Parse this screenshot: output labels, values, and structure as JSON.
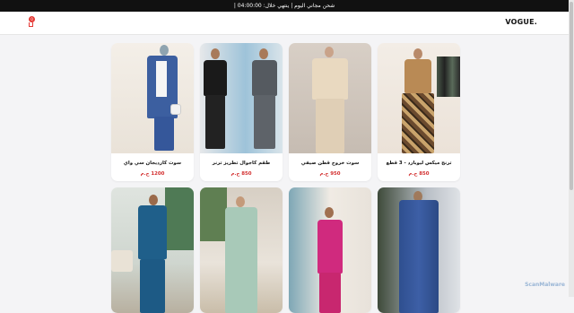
{
  "topbar": {
    "text": "| شحن مجاني اليوم | ينتهي خلال: 04:00:00"
  },
  "header": {
    "logo": "VOGUE.",
    "cart_count": "0"
  },
  "products": [
    {
      "title": "ترنج ميكس ليوبارد - 3 قطع",
      "price": "850 ج.م"
    },
    {
      "title": "سوت خروج قطن صيفي",
      "price": "950 ج.م"
    },
    {
      "title": "طقم كاجوال تطريز ترنر",
      "price": "850 ج.م"
    },
    {
      "title": "سوت كارديجان سي واي",
      "price": "1200 ج.م"
    }
  ],
  "watermark": "ScanMalware"
}
